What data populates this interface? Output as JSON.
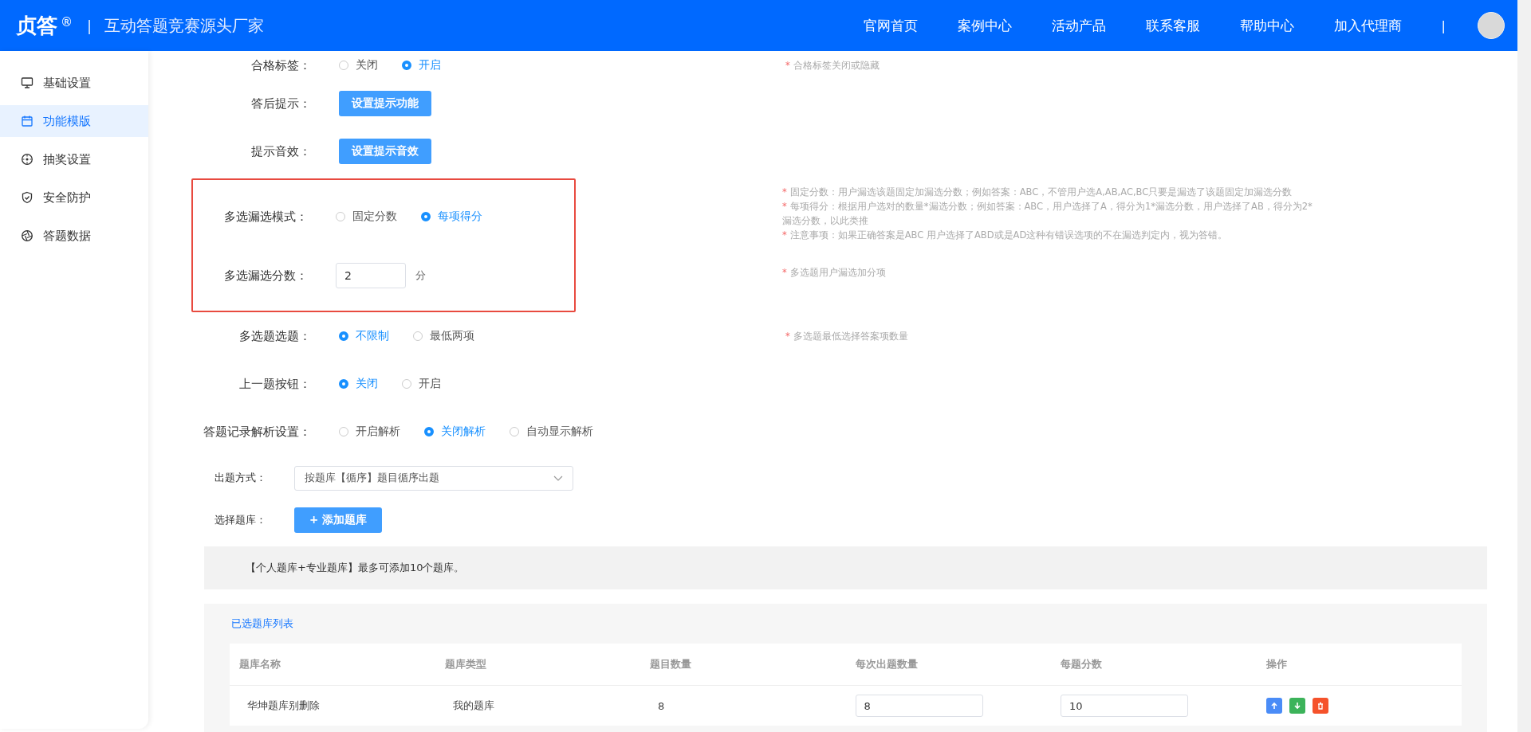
{
  "header": {
    "logo": "贞答",
    "registered": "®",
    "divider": "|",
    "slogan": "互动答题竞赛源头厂家",
    "nav": [
      "官网首页",
      "案例中心",
      "活动产品",
      "联系客服",
      "帮助中心",
      "加入代理商"
    ],
    "nav_divider": "|"
  },
  "sidebar": {
    "items": [
      {
        "label": "基础设置",
        "selected": false
      },
      {
        "label": "功能模版",
        "selected": true
      },
      {
        "label": "抽奖设置",
        "selected": false
      },
      {
        "label": "安全防护",
        "selected": false
      },
      {
        "label": "答题数据",
        "selected": false
      }
    ]
  },
  "settings": {
    "rows": [
      {
        "kind": "radio",
        "label": "合格标签：",
        "highlighted": false,
        "options": [
          {
            "label": "关闭",
            "selected": false
          },
          {
            "label": "开启",
            "selected": true
          }
        ],
        "hints": [
          {
            "mark": "*",
            "text": "合格标签关闭或隐藏"
          }
        ]
      },
      {
        "kind": "button",
        "label": "答后提示：",
        "highlighted": false,
        "button": "设置提示功能"
      },
      {
        "kind": "button",
        "label": "提示音效：",
        "highlighted": false,
        "button": "设置提示音效"
      },
      {
        "kind": "radio",
        "label": "多选漏选模式：",
        "highlighted": true,
        "options": [
          {
            "label": "固定分数",
            "selected": false
          },
          {
            "label": "每项得分",
            "selected": true
          }
        ],
        "hints": [
          {
            "mark": "*",
            "text": "固定分数：用户漏选该题固定加漏选分数；例如答案：ABC，不管用户选A,AB,AC,BC只要是漏选了该题固定加漏选分数"
          },
          {
            "mark": "*",
            "text": "每项得分：根据用户选对的数量*漏选分数；例如答案：ABC，用户选择了A，得分为1*漏选分数，用户选择了AB，得分为2*漏选分数，以此类推"
          },
          {
            "mark": "*",
            "text": "注意事项：如果正确答案是ABC 用户选择了ABD或是AD这种有错误选项的不在漏选判定内，视为答错。"
          }
        ]
      },
      {
        "kind": "number",
        "label": "多选漏选分数：",
        "highlighted": true,
        "value": "2",
        "unit": "分",
        "hints": [
          {
            "mark": "*",
            "text": "多选题用户漏选加分项"
          }
        ]
      },
      {
        "kind": "radio",
        "label": "多选题选题：",
        "highlighted": false,
        "options": [
          {
            "label": "不限制",
            "selected": true
          },
          {
            "label": "最低两项",
            "selected": false
          }
        ],
        "hints": [
          {
            "mark": "*",
            "text": "多选题最低选择答案项数量"
          }
        ]
      },
      {
        "kind": "radio",
        "label": "上一题按钮：",
        "highlighted": false,
        "options": [
          {
            "label": "关闭",
            "selected": true
          },
          {
            "label": "开启",
            "selected": false
          }
        ]
      },
      {
        "kind": "radio",
        "label": "答题记录解析设置：",
        "highlighted": false,
        "options": [
          {
            "label": "开启解析",
            "selected": false
          },
          {
            "label": "关闭解析",
            "selected": true
          },
          {
            "label": "自动显示解析",
            "selected": false
          }
        ]
      }
    ]
  },
  "question_source": {
    "rows": [
      {
        "kind": "select",
        "label": "出题方式：",
        "value": "按题库【循序】题目循序出题"
      },
      {
        "kind": "button",
        "label": "选择题库：",
        "button": "+ 添加题库"
      }
    ],
    "notice": "【个人题库+专业题库】最多可添加10个题库。"
  },
  "bank_list": {
    "title": "已选题库列表",
    "columns": [
      "题库名称",
      "题库类型",
      "题目数量",
      "每次出题数量",
      "每题分数",
      "操作"
    ],
    "rows": [
      {
        "name": "华坤题库别删除",
        "type": "我的题库",
        "count": "8",
        "per_draw": "8",
        "score": "10"
      }
    ]
  }
}
